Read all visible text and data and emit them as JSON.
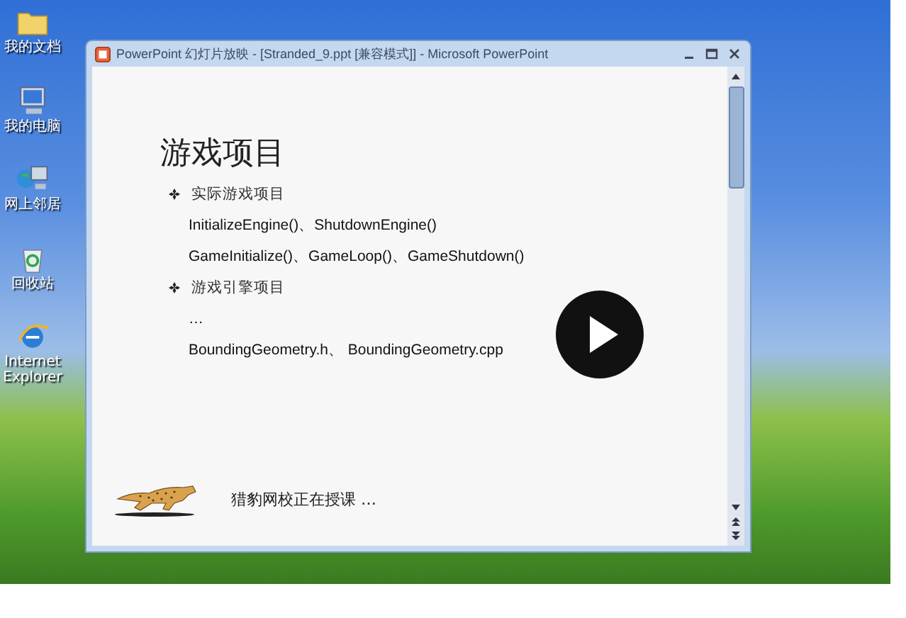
{
  "desktop_icons": [
    {
      "kind": "folder",
      "label": "我的文档"
    },
    {
      "kind": "computer",
      "label": "我的电脑"
    },
    {
      "kind": "network",
      "label": "网上邻居"
    },
    {
      "kind": "recycle",
      "label": "回收站"
    },
    {
      "kind": "browser",
      "label": "Internet Explorer"
    }
  ],
  "window": {
    "title": "PowerPoint 幻灯片放映 - [Stranded_9.ppt [兼容模式]] - Microsoft PowerPoint"
  },
  "slide": {
    "title": "游戏项目",
    "items": [
      {
        "kind": "bullet",
        "text": "实际游戏项目"
      },
      {
        "kind": "line",
        "text": "InitializeEngine()、ShutdownEngine()"
      },
      {
        "kind": "line",
        "text": "GameInitialize()、GameLoop()、GameShutdown()"
      },
      {
        "kind": "bullet",
        "text": "游戏引擎项目"
      },
      {
        "kind": "line",
        "text": "…"
      },
      {
        "kind": "line",
        "text": "BoundingGeometry.h、 BoundingGeometry.cpp"
      }
    ],
    "caption": "猎豹网校正在授课 …"
  }
}
